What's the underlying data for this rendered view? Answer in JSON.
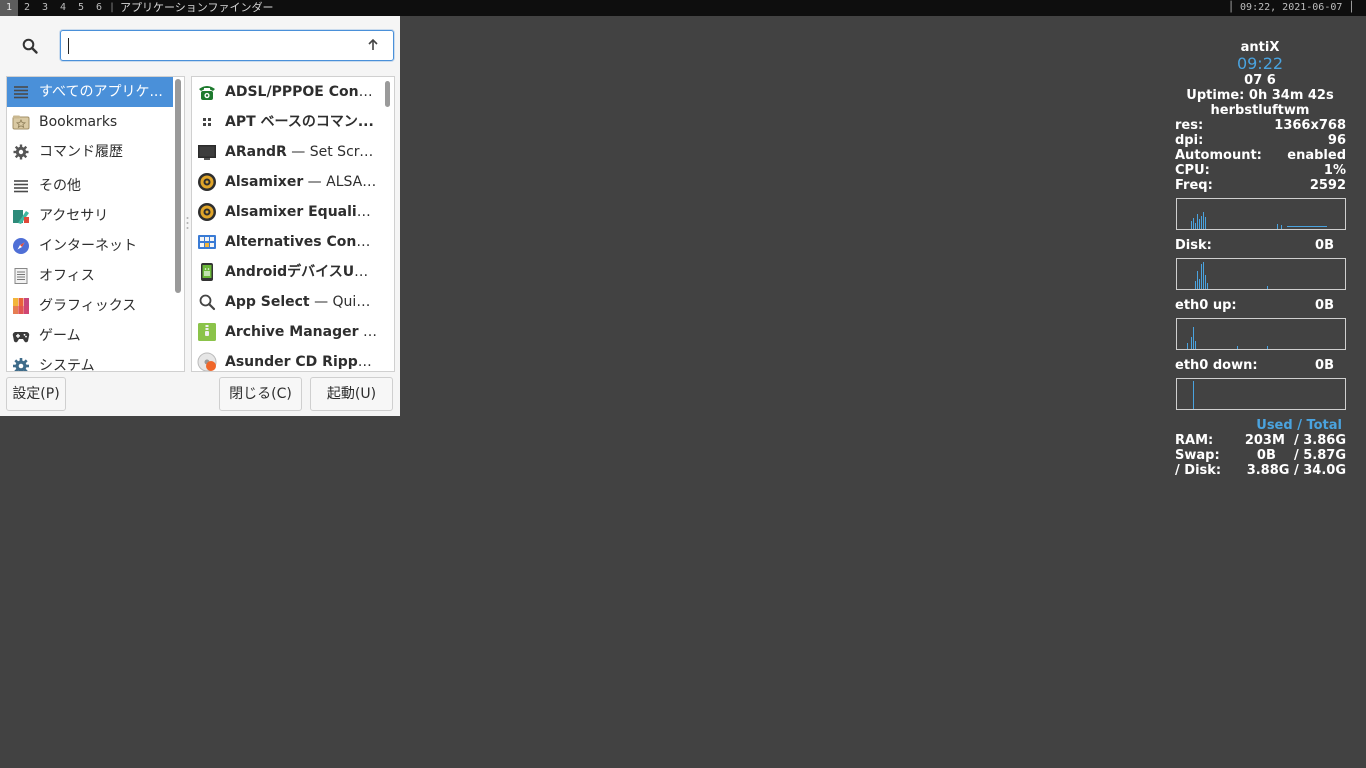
{
  "panel": {
    "workspaces": [
      "1",
      "2",
      "3",
      "4",
      "5",
      "6"
    ],
    "separator": "|",
    "window_title": "アプリケーションファインダー",
    "clock": "│ 09:22, 2021-06-07 │"
  },
  "finder": {
    "search": {
      "value": "",
      "placeholder": ""
    },
    "categories": [
      {
        "label": "すべてのアプリケ...",
        "icon": "list-icon",
        "selected": true
      },
      {
        "label": "Bookmarks",
        "icon": "bookmark-folder-icon"
      },
      {
        "label": "コマンド履歴",
        "icon": "gear-icon"
      },
      {
        "label": "その他",
        "icon": "list-icon"
      },
      {
        "label": "アクセサリ",
        "icon": "accessories-icon"
      },
      {
        "label": "インターネット",
        "icon": "compass-icon"
      },
      {
        "label": "オフィス",
        "icon": "document-icon"
      },
      {
        "label": "グラフィックス",
        "icon": "palette-icon"
      },
      {
        "label": "ゲーム",
        "icon": "gamepad-icon"
      },
      {
        "label": "システム",
        "icon": "system-gear-icon"
      }
    ],
    "apps": [
      {
        "name": "ADSL/PPPOE Config...",
        "desc": "",
        "icon": "phone-icon"
      },
      {
        "name": "APT ベースのコマン...",
        "desc": "",
        "icon": "apt-grid-icon"
      },
      {
        "name": "ARandR",
        "desc": " — Set Scree...",
        "icon": "monitor-icon"
      },
      {
        "name": "Alsamixer",
        "desc": " — ALSA オ...",
        "icon": "speaker-icon"
      },
      {
        "name": "Alsamixer Equalizer ...",
        "desc": "",
        "icon": "speaker-icon"
      },
      {
        "name": "Alternatives Config...",
        "desc": "",
        "icon": "alternatives-icon"
      },
      {
        "name": "AndroidデバイスUSB...",
        "desc": "",
        "icon": "android-icon"
      },
      {
        "name": "App Select",
        "desc": " — Quick ...",
        "icon": "magnifier-icon"
      },
      {
        "name": "Archive Manager",
        "desc": " — ...",
        "icon": "archive-icon"
      },
      {
        "name": "Asunder CD Ripper ...",
        "desc": "",
        "icon": "cd-ripper-icon"
      }
    ],
    "buttons": {
      "settings": "設定(P)",
      "close": "閉じる(C)",
      "launch": "起動(U)"
    }
  },
  "conky": {
    "host": "antiX",
    "time": "09:22",
    "date": "\u0000 07  6\u0000",
    "date_display": " 07  6",
    "uptime": "Uptime: 0h 34m 42s",
    "wm": "herbstluftwm",
    "stats": [
      {
        "k": "res:",
        "v": "1366x768"
      },
      {
        "k": "dpi:",
        "v": "96"
      },
      {
        "k": "Automount:",
        "v": "enabled"
      },
      {
        "k": "CPU:",
        "v": "1%"
      },
      {
        "k": "Freq:",
        "v": "2592"
      }
    ],
    "disk": {
      "k": "Disk:",
      "v": "0B"
    },
    "eth_up": {
      "k": "eth0 up:",
      "v": "0B"
    },
    "eth_down": {
      "k": "eth0 down:",
      "v": "0B"
    },
    "mem_header": "Used / Total",
    "mem": [
      {
        "k": "RAM:",
        "v": "203M  / 3.86G"
      },
      {
        "k": "Swap:",
        "v": "0B    / 5.87G"
      },
      {
        "k": "/ Disk:",
        "v": "3.88G / 34.0G"
      }
    ],
    "accent_color": "#4aa3df"
  }
}
